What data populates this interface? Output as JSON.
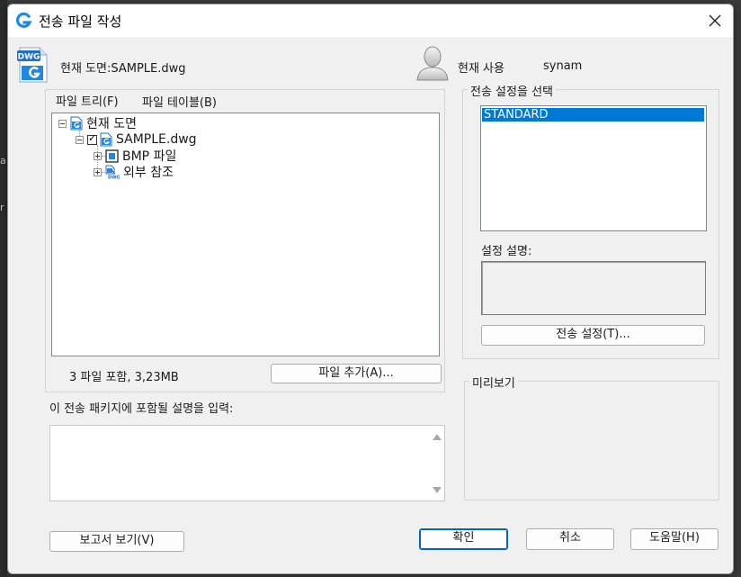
{
  "window": {
    "title": "전송 파일 작성"
  },
  "header": {
    "drawing_label": "현재 도면:SAMPLE.dwg",
    "user_label": "현재 사용",
    "user_name": "synam",
    "dwg_icon_text": "DWG"
  },
  "tabs": [
    "파일 트리(F)",
    "파일 테이블(B)"
  ],
  "tree": {
    "items": [
      {
        "label": "현재 도면",
        "expanded": true
      },
      {
        "label": "SAMPLE.dwg",
        "expanded": true,
        "checked": true
      },
      {
        "label": "BMP 파일",
        "expanded": false
      },
      {
        "label": "외부 참조",
        "expanded": false
      }
    ]
  },
  "file_summary": "3 파일 포함, 3,23MB",
  "buttons": {
    "add_file": "파일 추가(A)...",
    "transmit_setup": "전송 설정(T)...",
    "view_report": "보고서 보기(V)",
    "ok": "확인",
    "cancel": "취소",
    "help": "도움말(H)"
  },
  "settings": {
    "group_label": "전송 설정을 선택",
    "items": [
      "STANDARD"
    ],
    "selected": "STANDARD",
    "description_label": "설정 설명:"
  },
  "preview": {
    "label": "미리보기"
  },
  "notes": {
    "label": "이 전송 패키지에 포함될 설명을 입력:"
  },
  "colors": {
    "selection": "#0078d7",
    "accent": "#1e88e5",
    "dialog_bg": "#f0f0f0"
  },
  "icons": {
    "app": "gstarcad-logo-icon",
    "close": "close-icon",
    "dwg": "dwg-file-icon",
    "user": "user-avatar-icon"
  }
}
